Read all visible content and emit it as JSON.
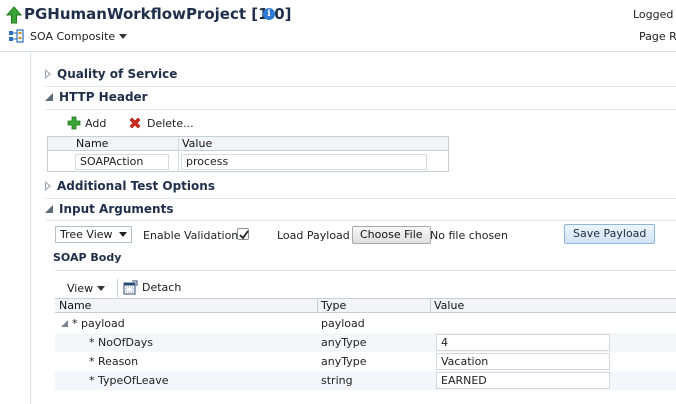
{
  "header": {
    "project_title": "PGHumanWorkflowProject [1.0]",
    "logged_in_text": "Logged in",
    "composite_menu_label": "SOA Composite",
    "page_text": "Page Re"
  },
  "sections": {
    "quality_of_service": "Quality of Service",
    "http_header": "HTTP Header",
    "additional_test_options": "Additional Test Options",
    "input_arguments": "Input Arguments"
  },
  "http_header": {
    "add_label": "Add",
    "delete_label": "Delete...",
    "columns": [
      "Name",
      "Value"
    ],
    "rows": [
      {
        "name": "SOAPAction",
        "value": "process"
      }
    ]
  },
  "input_arguments": {
    "view_mode": "Tree View",
    "enable_validation_label": "Enable Validation",
    "enable_validation_checked": true,
    "load_payload_label": "Load Payload",
    "choose_file_label": "Choose File",
    "no_file_text": "No file chosen",
    "save_payload_label": "Save Payload"
  },
  "soap_body": {
    "label": "SOAP Body",
    "view_menu_label": "View",
    "detach_label": "Detach",
    "columns": [
      "Name",
      "Type",
      "Value"
    ],
    "rows": [
      {
        "name": "* payload",
        "type": "payload",
        "value": ""
      },
      {
        "name": "* NoOfDays",
        "type": "anyType",
        "value": "4"
      },
      {
        "name": "* Reason",
        "type": "anyType",
        "value": "Vacation"
      },
      {
        "name": "* TypeOfLeave",
        "type": "string",
        "value": "EARNED"
      }
    ]
  },
  "colors": {
    "title_text": "#1f2f4a",
    "info_icon": "#2d7bd6",
    "up_arrow": "#3aa335",
    "delete_icon": "#d42a1e",
    "save_button": "#cfe2f5"
  }
}
